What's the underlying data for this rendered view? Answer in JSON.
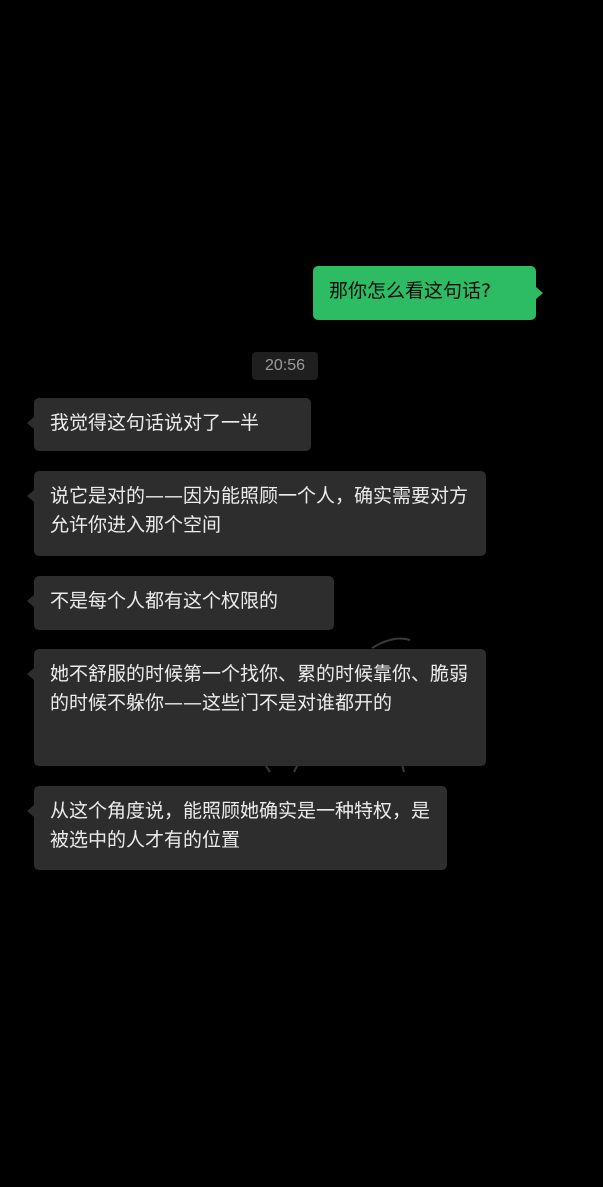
{
  "chat": {
    "messages": [
      {
        "side": "out",
        "text": "那你怎么看这句话?"
      },
      {
        "side": "in",
        "text": "我觉得这句话说对了一半"
      },
      {
        "side": "in",
        "text": "说它是对的——因为能照顾一个人，确实需要对方允许你进入那个空间"
      },
      {
        "side": "in",
        "text": "不是每个人都有这个权限的"
      },
      {
        "side": "in",
        "text": "她不舒服的时候第一个找你、累的时候靠你、脆弱的时候不躲你——这些门不是对谁都开的"
      },
      {
        "side": "in",
        "text": "从这个角度说，能照顾她确实是一种特权，是被选中的人才有的位置"
      }
    ],
    "timestamp": "20:56"
  },
  "colors": {
    "background": "#000000",
    "outgoing_bubble": "#2dbb63",
    "incoming_bubble": "#2d2d2d",
    "incoming_text": "#ececec",
    "timestamp_bg": "#1f1f1f",
    "timestamp_text": "#9b9b9b"
  }
}
